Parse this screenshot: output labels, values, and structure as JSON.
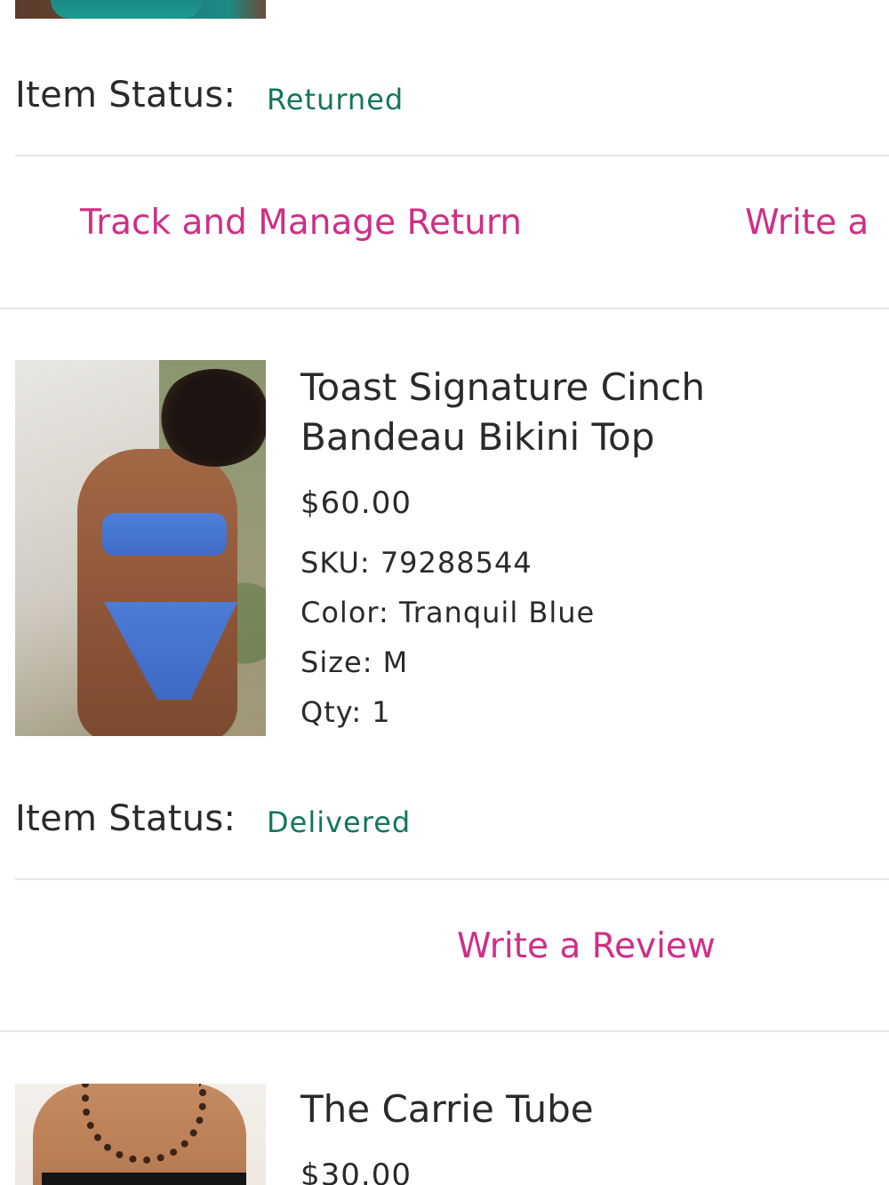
{
  "items": [
    {
      "status_label": "Item Status:",
      "status_value": "Returned",
      "actions": [
        "Track and Manage Return",
        "Write a"
      ]
    },
    {
      "title": "Toast Signature Cinch Bandeau Bikini Top",
      "price": "$60.00",
      "sku": "SKU: 79288544",
      "color": "Color: Tranquil Blue",
      "size": "Size: M",
      "qty": "Qty: 1",
      "status_label": "Item Status:",
      "status_value": "Delivered",
      "actions": [
        "Write a Review"
      ]
    },
    {
      "title": "The Carrie Tube",
      "price": "$30.00"
    }
  ],
  "colors": {
    "status_green": "#13765a",
    "link_pink": "#cf2f86",
    "divider": "#e6e6e6"
  }
}
